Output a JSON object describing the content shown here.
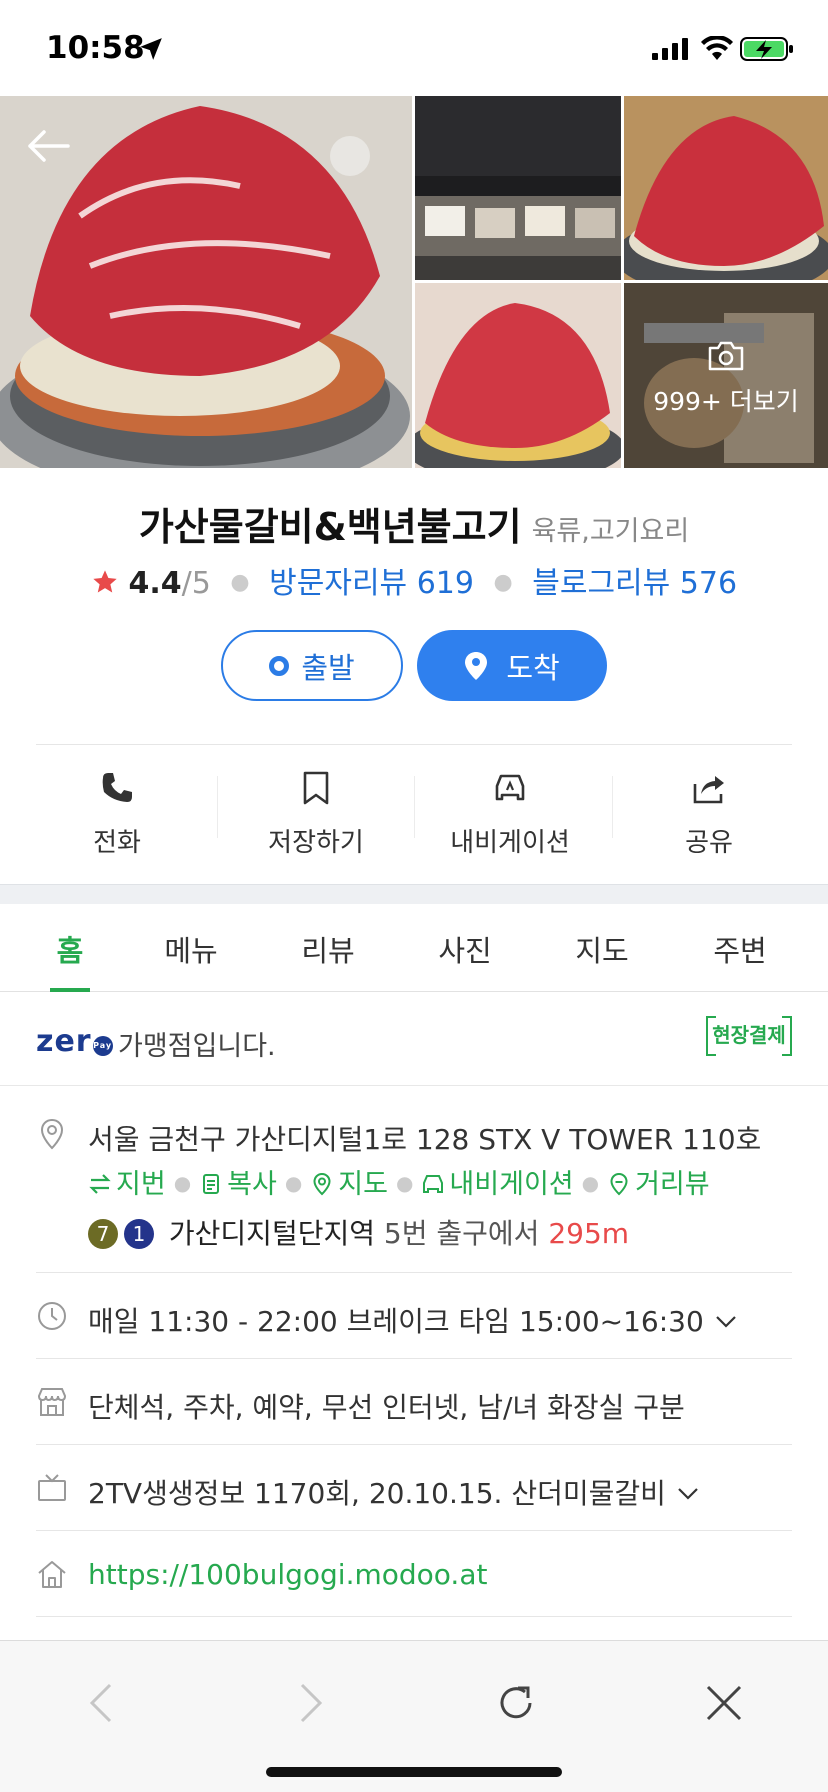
{
  "status_bar": {
    "time": "10:58"
  },
  "photos": {
    "more_label": "999+ 더보기"
  },
  "place": {
    "name": "가산물갈비&백년불고기",
    "category": "육류,고기요리",
    "rating": "4.4",
    "rating_max": "/5",
    "visitor_reviews": "방문자리뷰 619",
    "blog_reviews": "블로그리뷰 576"
  },
  "route": {
    "depart_label": "출발",
    "arrive_label": "도착"
  },
  "actions": [
    {
      "label": "전화",
      "icon": "phone-icon"
    },
    {
      "label": "저장하기",
      "icon": "bookmark-icon"
    },
    {
      "label": "내비게이션",
      "icon": "car-navigation-icon"
    },
    {
      "label": "공유",
      "icon": "share-icon"
    }
  ],
  "tabs": [
    {
      "label": "홈",
      "active": true
    },
    {
      "label": "메뉴"
    },
    {
      "label": "리뷰"
    },
    {
      "label": "사진"
    },
    {
      "label": "지도"
    },
    {
      "label": "주변"
    }
  ],
  "zeropay": {
    "logo": "zer",
    "pay_badge": "Pay",
    "text": "가맹점입니다.",
    "onsite_label": "현장결제"
  },
  "address": {
    "text": "서울 금천구 가산디지털1로 128 STX V TOWER 110호",
    "links": [
      "지번",
      "복사",
      "지도",
      "내비게이션",
      "거리뷰"
    ]
  },
  "subway": {
    "line_a": "7",
    "line_b": "1",
    "station": "가산디지털단지역",
    "exit": "5번 출구에서",
    "distance": "295m"
  },
  "hours": {
    "text": "매일 11:30 - 22:00 브레이크 타임 15:00~16:30"
  },
  "facilities": {
    "text": "단체석, 주차, 예약, 무선 인터넷, 남/녀 화장실 구분"
  },
  "tv": {
    "text": "2TV생생정보 1170회, 20.10.15. 산더미물갈비"
  },
  "website": {
    "url": "https://100bulgogi.modoo.at"
  },
  "colors": {
    "accent_green": "#26a94f",
    "accent_blue": "#2f80ee",
    "distance_red": "#e84a4a"
  }
}
